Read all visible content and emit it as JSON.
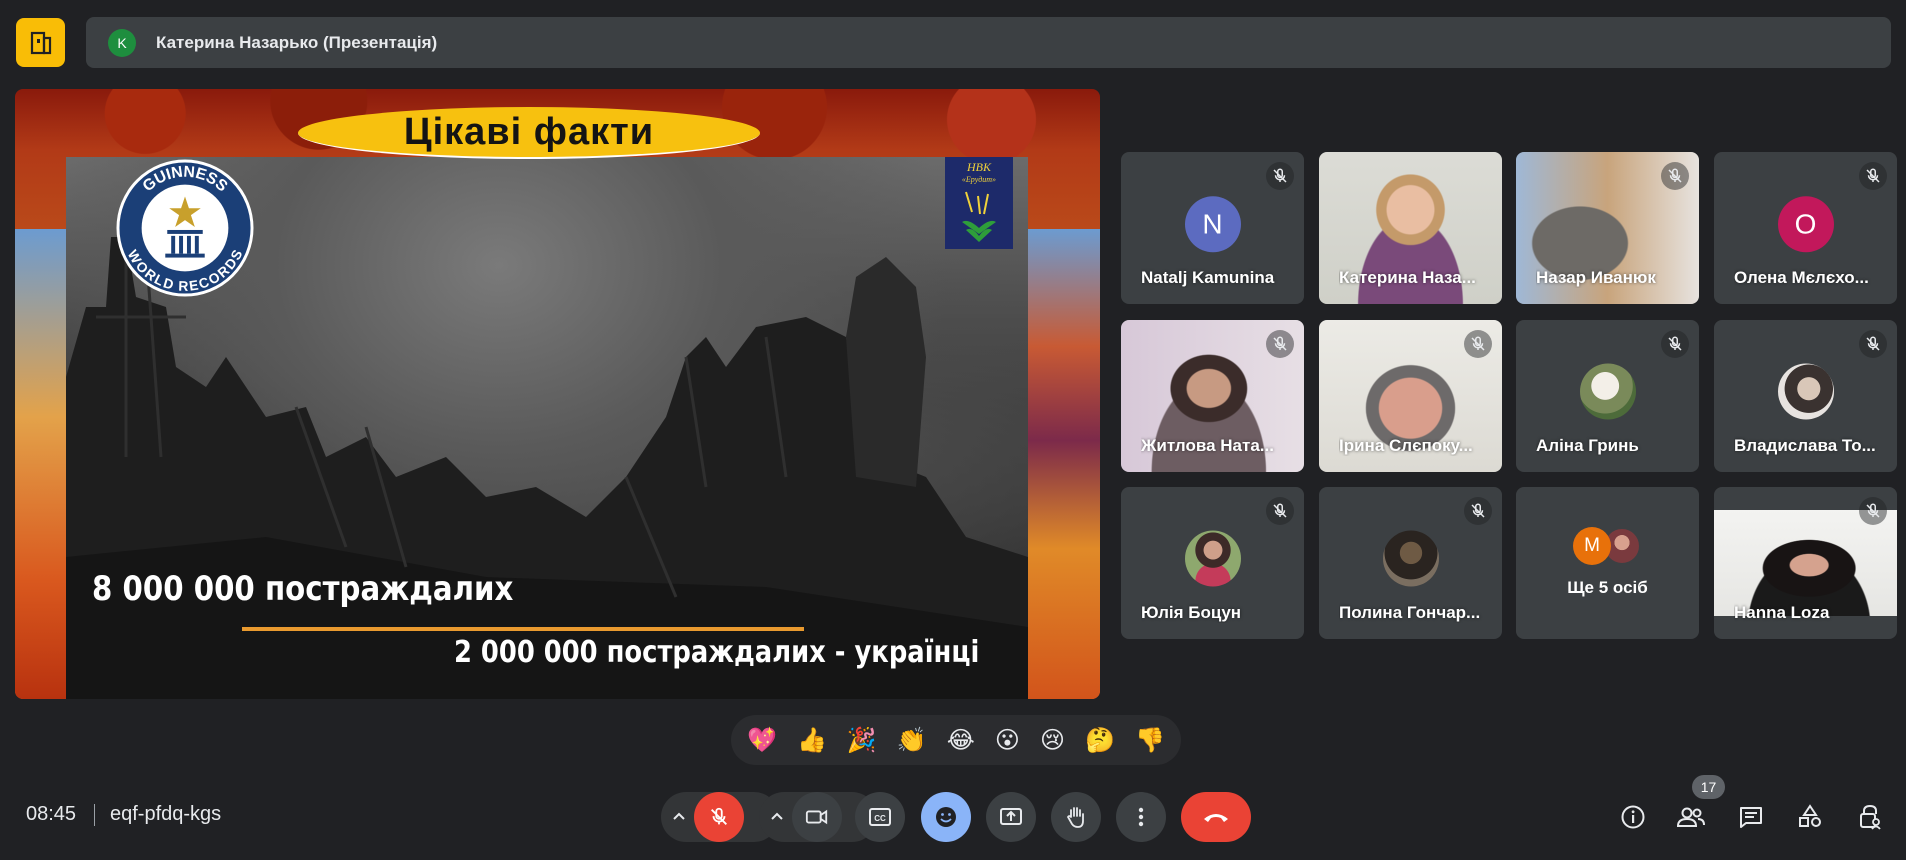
{
  "header": {
    "presenter_initial": "K",
    "presenter_label": "Катерина Назарько (Презентація)"
  },
  "slide": {
    "title": "Цікаві факти",
    "logo_left": "GUINNESS WORLD RECORDS",
    "logo_right_line1": "НВК",
    "logo_right_line2": "«Ерудит»",
    "caption_main": "8 000 000 постраждалих",
    "caption_sub": "2 000 000 постраждалих - українці"
  },
  "participants": [
    {
      "name": "Natalj Kamunina",
      "initial": "N",
      "color": "#5c6bc0"
    },
    {
      "name": "Катерина Наза..."
    },
    {
      "name": "Назар Иванюк"
    },
    {
      "name": "Олена Мєлєхо...",
      "initial": "О",
      "color": "#c2185b"
    },
    {
      "name": "Житлова Ната..."
    },
    {
      "name": "Ірина Слєпоку..."
    },
    {
      "name": "Аліна Гринь"
    },
    {
      "name": "Владислава То..."
    },
    {
      "name": "Юлія Боцун"
    },
    {
      "name": "Полина Гончар..."
    },
    {
      "name": "Ще 5 осіб",
      "initial": "M",
      "color": "#e8710a"
    },
    {
      "name": "Hanna Loza"
    }
  ],
  "reactions": [
    "💖",
    "👍",
    "🎉",
    "👏",
    "😂",
    "😮",
    "😢",
    "🤔",
    "👎"
  ],
  "footer": {
    "time": "08:45",
    "meeting_code": "eqf-pfdq-kgs",
    "people_count": "17"
  }
}
